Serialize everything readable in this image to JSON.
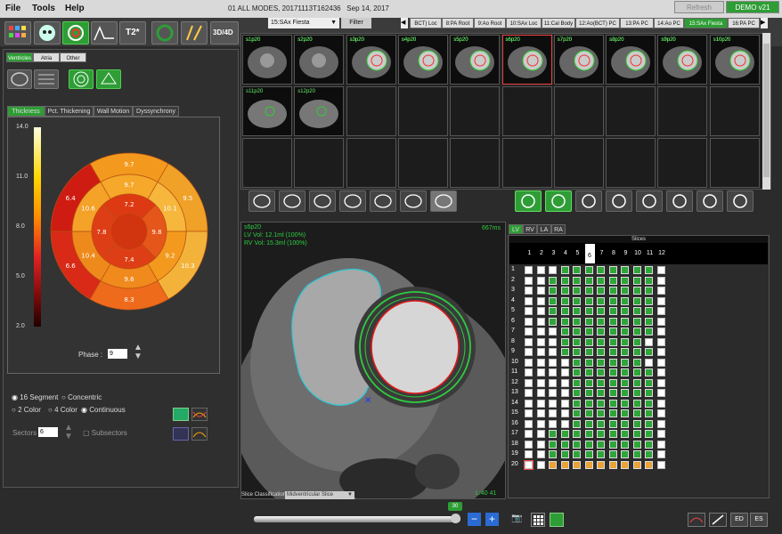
{
  "menu": {
    "file": "File",
    "tools": "Tools",
    "help": "Help"
  },
  "title_bar": {
    "study": "01 ALL MODES, 20171113T162436",
    "date": "Sep 14, 2017",
    "refresh": "Refresh",
    "demo": "DEMO v21"
  },
  "toolbar": {
    "mode_3d4d": "3D/4D",
    "t2star": "T2*"
  },
  "series": {
    "selected": "15:SAx Fiesta",
    "filter": "Filter"
  },
  "series_tabs": [
    "BCT) Loc",
    "8:PA Root",
    "9:Ao Root",
    "10:SAx Loc",
    "11:Cal Body",
    "12:Ao(BCT) PC",
    "13:PA PC",
    "14:Ao PC",
    "15:SAx Fiesta",
    "16:PA PC"
  ],
  "subtabs": [
    "Ventricles",
    "Atria",
    "Other"
  ],
  "graph_tabs": [
    "Thickness",
    "Pct. Thickening",
    "Wall Motion",
    "Dyssynchrony"
  ],
  "colorbar": {
    "ticks": [
      "14.0",
      "11.0",
      "8.0",
      "5.0",
      "2.0"
    ]
  },
  "bullseye": {
    "values": [
      "9.7",
      "9.5",
      "10.3",
      "8.3",
      "6.6",
      "6.4",
      "9.7",
      "10.1",
      "9.2",
      "9.6",
      "10.4",
      "10.6",
      "7.2",
      "9.8",
      "7.4",
      "7.8"
    ]
  },
  "phase": {
    "label": "Phase :",
    "value": "9"
  },
  "options": {
    "seg16": "16 Segment",
    "concentric": "Concentric",
    "color2": "2 Color",
    "color4": "4 Color",
    "continuous": "Continuous",
    "sectors_label": "Sectors",
    "sectors_value": "6",
    "subsectors": "Subsectors"
  },
  "thumbs_row1": [
    "s1p20",
    "s2p20",
    "s3p20",
    "s4p20",
    "s5p20",
    "s6p20",
    "s7p20",
    "s8p20",
    "s9p20",
    "s10p20"
  ],
  "thumbs_row2": [
    "s11p20",
    "s12p20"
  ],
  "viewer": {
    "info1": "s6p20",
    "info2": "LV Vol: 12.1ml (100%)",
    "info3": "RV Vol: 15.3ml (100%)",
    "ms": "667ms",
    "wl": "L:40 41",
    "slice_class_label": "Slice Classification",
    "slice_class_value": "Midventricular Slice",
    "cine_value": "30"
  },
  "chambers": [
    "LV",
    "RV",
    "LA",
    "RA"
  ],
  "grid": {
    "header": "Slices",
    "cols": [
      "1",
      "2",
      "3",
      "4",
      "5",
      "6",
      "7",
      "8",
      "9",
      "10",
      "11",
      "12"
    ],
    "rows": [
      "1",
      "2",
      "3",
      "4",
      "5",
      "6",
      "7",
      "8",
      "9",
      "10",
      "11",
      "12",
      "13",
      "14",
      "15",
      "16",
      "17",
      "18",
      "19",
      "20"
    ],
    "active_col": "6"
  },
  "bottom": {
    "ed": "ED",
    "es": "ES",
    "minus": "−",
    "plus": "+"
  },
  "colors": {
    "accent": "#2e9d35",
    "lv": "#e01c1c",
    "epi": "#2ecc40",
    "rv": "#31c6d4"
  }
}
